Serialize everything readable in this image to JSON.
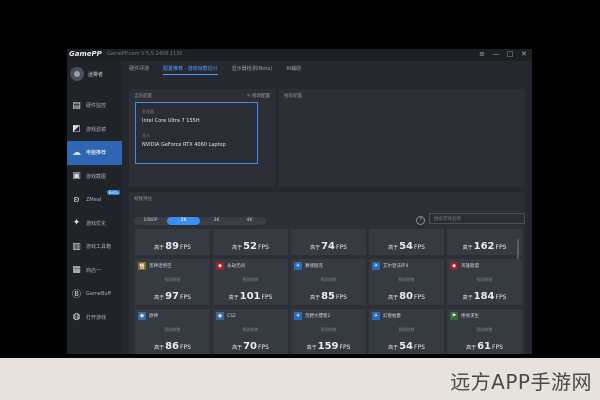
{
  "app": {
    "logo": "GamePP",
    "version": "GamePP.com  V 5.5.2408.1130",
    "window_controls": [
      "≡",
      "—",
      "□",
      "✕"
    ]
  },
  "user": {
    "name": "迷雾者"
  },
  "sidebar": {
    "items": [
      {
        "label": "硬件监控",
        "icon": "monitor-icon",
        "glyph": "▤",
        "active": false,
        "beta": false
      },
      {
        "label": "游戏滤镜",
        "icon": "filter-icon",
        "glyph": "◩",
        "active": false,
        "beta": false
      },
      {
        "label": "电脑推荐",
        "icon": "cloud-icon",
        "glyph": "☁",
        "active": true,
        "beta": false
      },
      {
        "label": "游戏截图",
        "icon": "screenshot-icon",
        "glyph": "▣",
        "active": false,
        "beta": false
      },
      {
        "label": "ZMeal",
        "icon": "rabbit-icon",
        "glyph": "ʚ",
        "active": false,
        "beta": true,
        "beta_label": "Beta"
      },
      {
        "label": "游戏优化",
        "icon": "rocket-icon",
        "glyph": "✦",
        "active": false,
        "beta": false
      },
      {
        "label": "游戏工具箱",
        "icon": "toolbox-icon",
        "glyph": "▥",
        "active": false,
        "beta": false
      },
      {
        "label": "商店一",
        "icon": "store-icon",
        "glyph": "▦",
        "active": false,
        "beta": false
      },
      {
        "label": "GameBuff",
        "icon": "buff-icon",
        "glyph": "Ⓑ",
        "active": false,
        "beta": false
      },
      {
        "label": "打开游戏",
        "icon": "game-icon",
        "glyph": "◍",
        "active": false,
        "beta": false
      }
    ]
  },
  "topnav": {
    "tabs": [
      {
        "label": "硬件评测",
        "active": false
      },
      {
        "label": "配置推荐 · 游戏帧数估计",
        "active": true
      },
      {
        "label": "显示器检测(Beta)",
        "active": false
      },
      {
        "label": "AI辅助",
        "active": false
      }
    ]
  },
  "hardware": {
    "title": "当前配置",
    "action": "✎ 修改配置",
    "cpu_label": "处理器",
    "cpu": "Intel Core Ultra 7 155H",
    "gpu_label": "显卡",
    "gpu": "NVIDIA GeForce RTX 4060 Laptop"
  },
  "hardware_right": {
    "title": "推荐配置"
  },
  "fps_panel": {
    "title": "帧数预估",
    "resolutions": [
      "1080P",
      "2K",
      "3K",
      "4K"
    ],
    "active_resolution": "2K",
    "help": "?",
    "search_placeholder": "搜索游戏名称"
  },
  "card_label": "预测帧数",
  "fps_prefix": "高于",
  "fps_unit": "FPS",
  "games_row1": [
    {
      "name": "",
      "fps": "89",
      "color": "#5a7a3a"
    },
    {
      "name": "",
      "fps": "52",
      "color": "#7a3a3a"
    },
    {
      "name": "",
      "fps": "74",
      "color": "#3a5a8a"
    },
    {
      "name": "",
      "fps": "54",
      "color": "#3a6a9a"
    },
    {
      "name": "",
      "fps": "162",
      "color": "#6a3a3a"
    }
  ],
  "games_row2": [
    {
      "name": "黑神话悟空",
      "fps": "97",
      "color": "#8a6a2a",
      "glyph": "悟"
    },
    {
      "name": "永劫无间",
      "fps": "101",
      "color": "#a02030",
      "glyph": "◆"
    },
    {
      "name": "赛博朋克",
      "fps": "85",
      "color": "#2a6ab8",
      "glyph": "✈"
    },
    {
      "name": "艾尔登法环4",
      "fps": "80",
      "color": "#2a6ab8",
      "glyph": "✈"
    },
    {
      "name": "英雄联盟",
      "fps": "184",
      "color": "#9a2030",
      "glyph": "◆"
    }
  ],
  "games_row3": [
    {
      "name": "原神",
      "fps": "86",
      "color": "#3a6a9a",
      "glyph": "◉"
    },
    {
      "name": "CS2",
      "fps": "70",
      "color": "#3a6a9a",
      "glyph": "◉"
    },
    {
      "name": "荒野大镖客2",
      "fps": "159",
      "color": "#2a6ab8",
      "glyph": "✈"
    },
    {
      "name": "幻兽帕鲁",
      "fps": "54",
      "color": "#2a6ab8",
      "glyph": "✈"
    },
    {
      "name": "绝地求生",
      "fps": "61",
      "color": "#3a6a3a",
      "glyph": "⚑"
    }
  ],
  "watermark": "远方APP手游网"
}
